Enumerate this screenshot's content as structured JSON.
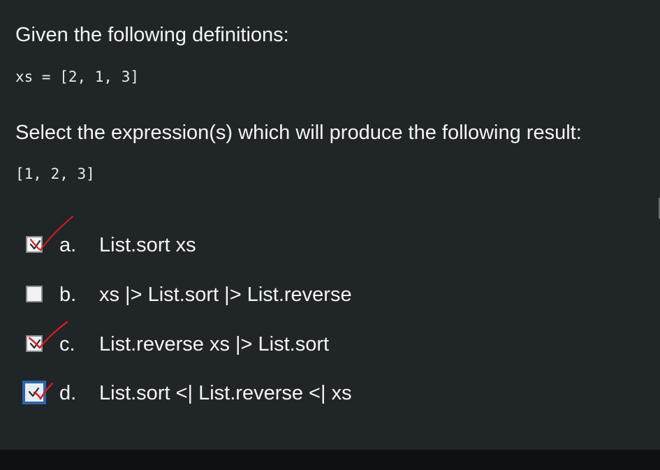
{
  "question": {
    "intro": "Given the following definitions:",
    "definition_code": "xs = [2, 1, 3]",
    "instruction": "Select the expression(s) which will produce the following result:",
    "result_code": "[1, 2, 3]"
  },
  "options": [
    {
      "letter": "a.",
      "text": "List.sort xs",
      "checked": true,
      "focused": false
    },
    {
      "letter": "b.",
      "text": "xs |> List.sort |> List.reverse",
      "checked": false,
      "focused": false
    },
    {
      "letter": "c.",
      "text": "List.reverse xs |> List.sort",
      "checked": true,
      "focused": false
    },
    {
      "letter": "d.",
      "text": "List.sort <| List.reverse <| xs",
      "checked": true,
      "focused": true
    }
  ],
  "colors": {
    "panel_background": "#202528",
    "bottom_bar": "#0f1012",
    "text": "#f3f4f5",
    "checkbox_fill": "#f2f2f2",
    "checkbox_border": "#8a8e91",
    "focus_ring": "#2f64a8",
    "handwritten_mark": "#d71920"
  },
  "icons": {
    "unchecked": "checkbox-empty-icon",
    "checked": "checkmark-icon",
    "annotation": "red-handwritten-check-icon"
  }
}
